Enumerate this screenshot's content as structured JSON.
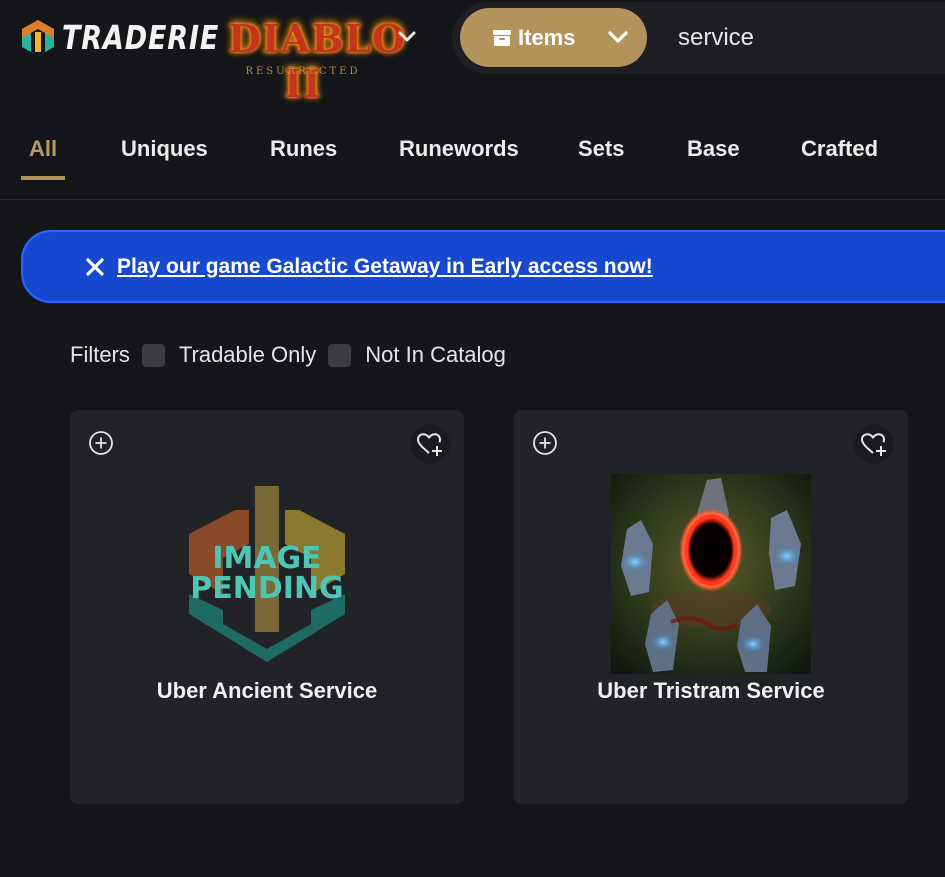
{
  "brand": {
    "name": "TRADERIE",
    "game_title": "DIABLO II",
    "game_subtitle": "RESURRECTED"
  },
  "search": {
    "category_label": "Items",
    "query": "service"
  },
  "tabs": [
    {
      "label": "All",
      "active": true
    },
    {
      "label": "Uniques"
    },
    {
      "label": "Runes"
    },
    {
      "label": "Runewords"
    },
    {
      "label": "Sets"
    },
    {
      "label": "Base"
    },
    {
      "label": "Crafted"
    }
  ],
  "banner": {
    "text": "Play our game Galactic Getaway in Early access now!"
  },
  "filters": {
    "label": "Filters",
    "options": [
      {
        "label": "Tradable Only",
        "checked": false
      },
      {
        "label": "Not In Catalog",
        "checked": false
      }
    ]
  },
  "items": [
    {
      "name": "Uber Ancient Service",
      "image": "image-pending",
      "pending_line1": "IMAGE",
      "pending_line2": "PENDING"
    },
    {
      "name": "Uber Tristram Service",
      "image": "portal-stones"
    }
  ],
  "colors": {
    "accent": "#b3925b",
    "banner": "#1748d0",
    "background": "#151619",
    "card": "#222327"
  }
}
